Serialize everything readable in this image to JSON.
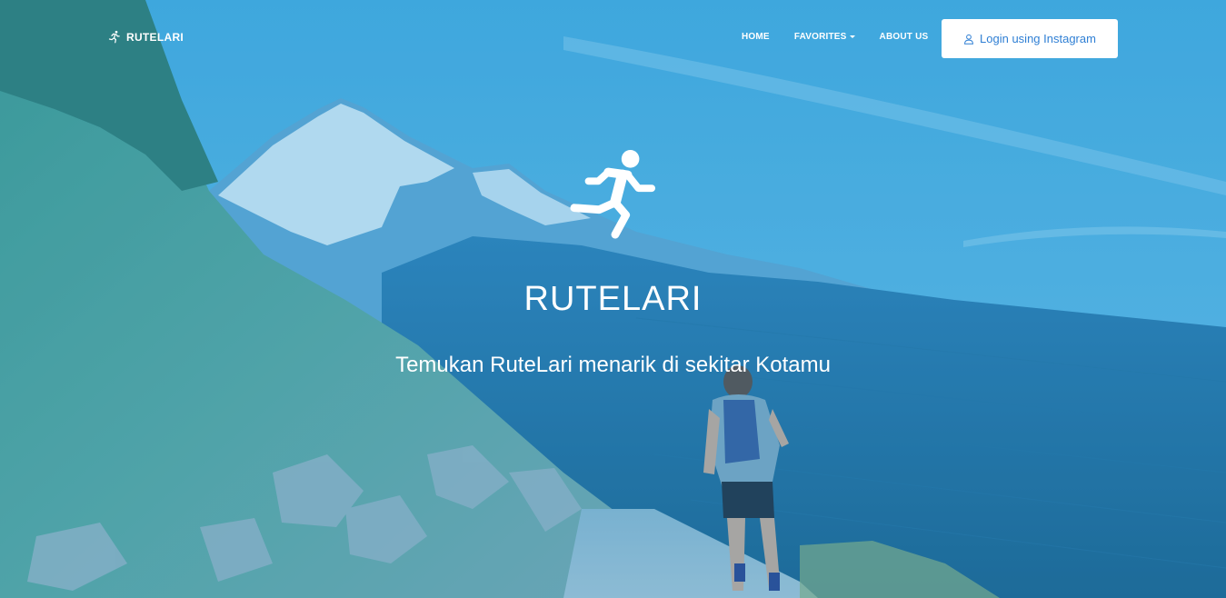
{
  "brand": {
    "name": "RUTELARI",
    "icon": "runner-icon"
  },
  "nav": {
    "home": "HOME",
    "favorites": "FAVORITES",
    "about": "ABOUT US",
    "login": "Login using Instagram"
  },
  "hero": {
    "title": "RUTELARI",
    "subtitle": "Temukan RuteLari menarik di sekitar Kotamu",
    "icon": "runner-icon"
  },
  "colors": {
    "login_text": "#2f7fd4",
    "overlay": "#2896d7"
  }
}
